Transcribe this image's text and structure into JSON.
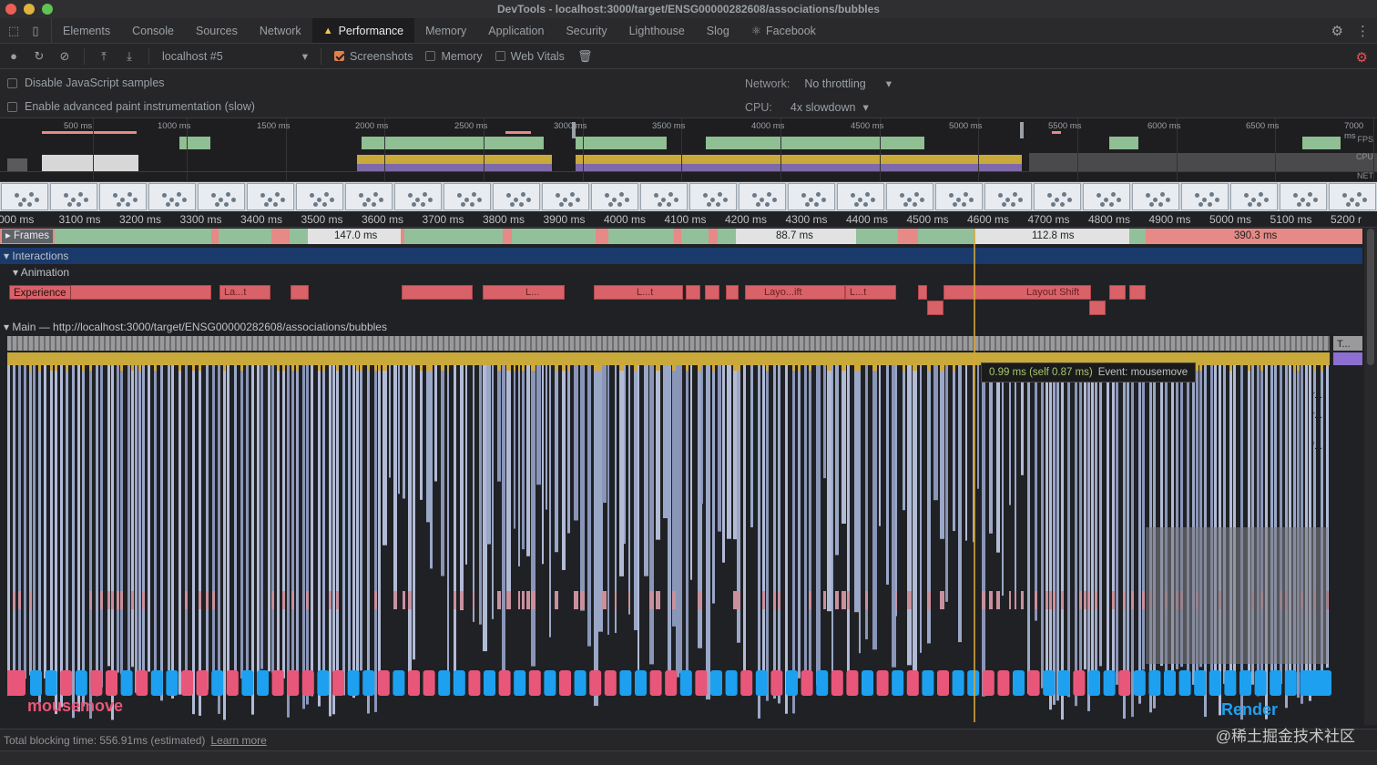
{
  "window": {
    "title": "DevTools - localhost:3000/target/ENSG00000282608/associations/bubbles"
  },
  "tabs": [
    {
      "label": "Elements",
      "active": false
    },
    {
      "label": "Console",
      "active": false
    },
    {
      "label": "Sources",
      "active": false
    },
    {
      "label": "Network",
      "active": false
    },
    {
      "label": "Performance",
      "active": true
    },
    {
      "label": "Memory",
      "active": false
    },
    {
      "label": "Application",
      "active": false
    },
    {
      "label": "Security",
      "active": false
    },
    {
      "label": "Lighthouse",
      "active": false
    },
    {
      "label": "Slog",
      "active": false
    },
    {
      "label": "Facebook",
      "active": false
    }
  ],
  "toolbar": {
    "target_select": "localhost #5",
    "screenshots_label": "Screenshots",
    "screenshots_checked": true,
    "memory_label": "Memory",
    "memory_checked": false,
    "webvitals_label": "Web Vitals",
    "webvitals_checked": false
  },
  "settings": {
    "disable_js_samples": "Disable JavaScript samples",
    "advanced_paint": "Enable advanced paint instrumentation (slow)",
    "network_label": "Network:",
    "network_value": "No throttling",
    "cpu_label": "CPU:",
    "cpu_value": "4x slowdown"
  },
  "overview": {
    "ticks": [
      "500 ms",
      "1000 ms",
      "1500 ms",
      "2000 ms",
      "2500 ms",
      "3000 ms",
      "3500 ms",
      "4000 ms",
      "4500 ms",
      "5000 ms",
      "5500 ms",
      "6000 ms",
      "6500 ms",
      "7000 ms"
    ],
    "fps_label": "FPS",
    "cpu_label": "CPU",
    "net_label": "NET"
  },
  "ruler": {
    "ticks": [
      "000 ms",
      "3100 ms",
      "3200 ms",
      "3300 ms",
      "3400 ms",
      "3500 ms",
      "3600 ms",
      "3700 ms",
      "3800 ms",
      "3900 ms",
      "4000 ms",
      "4100 ms",
      "4200 ms",
      "4300 ms",
      "4400 ms",
      "4500 ms",
      "4600 ms",
      "4700 ms",
      "4800 ms",
      "4900 ms",
      "5000 ms",
      "5100 ms",
      "5200 r"
    ]
  },
  "frames": {
    "label": "Frames",
    "durations": [
      "147.0 ms",
      "88.7 ms",
      "112.8 ms",
      "390.3 ms"
    ]
  },
  "tracks": {
    "interactions": "Interactions",
    "animation": "Animation",
    "experience": "Experience",
    "main": "Main — http://localhost:3000/target/ENSG00000282608/associations/bubbles"
  },
  "experience_labels": [
    "La...t",
    "L...",
    "L...t",
    "Layo...ift",
    "L...t",
    "Layout Shift"
  ],
  "flame_side_labels": [
    "T...",
    "r...",
    "r...",
    "f..."
  ],
  "tooltip": {
    "time": "0.99 ms (self 0.87 ms)",
    "event": "Event: mousemove"
  },
  "annotations": {
    "mousemove": "mousemove",
    "render": "Render"
  },
  "status": {
    "tbt": "Total blocking time: 556.91ms (estimated)",
    "learn_more": "Learn more"
  },
  "watermark": "@稀土掘金技术社区",
  "colors": {
    "mousemove": "#e8577a",
    "render": "#1ea0f0",
    "scripting": "#d4b44a",
    "task": "#9aa7c7",
    "frame_good": "#92c09a",
    "frame_bad": "#e58a86"
  }
}
